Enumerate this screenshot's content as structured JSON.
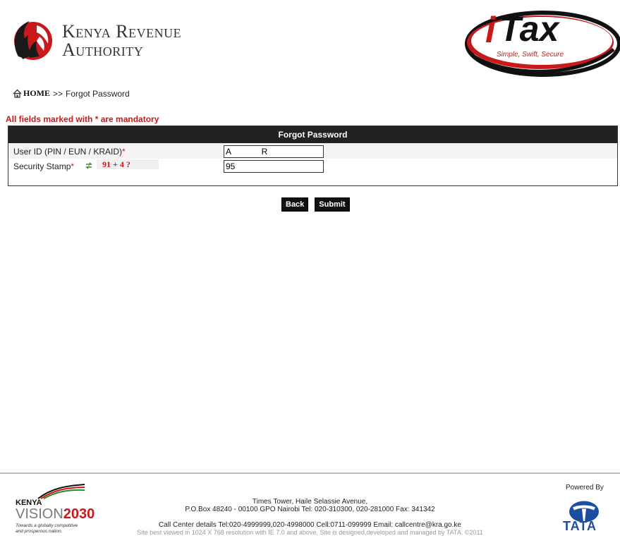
{
  "header": {
    "org_line1": "Kenya Revenue",
    "org_line2": "Authority",
    "itax_brand": "iTax",
    "itax_tagline": "Simple, Swift, Secure"
  },
  "breadcrumb": {
    "home": "HOME",
    "separator": ">>",
    "current": "Forgot Password"
  },
  "mandatory_note": "All fields marked with * are mandatory",
  "form": {
    "title": "Forgot Password",
    "user_id_label": "User ID (PIN / EUN / KRAID)",
    "user_id_value": "A             R",
    "security_label": "Security Stamp",
    "required_mark": "*",
    "captcha_text": "91 + 4 ?",
    "security_value": "95"
  },
  "buttons": {
    "back": "Back",
    "submit": "Submit"
  },
  "footer": {
    "vision_kenya": "KENYA",
    "vision_word": "VISION",
    "vision_year": "2030",
    "vision_tag1": "Towards a globally competitive",
    "vision_tag2": "and prosperous nation.",
    "address1": "Times Tower, Haile Selassie Avenue,",
    "address2": "P.O.Box 48240 - 00100 GPO Nairobi Tel: 020-310300, 020-281000 Fax: 341342",
    "callcenter": "Call Center details Tel:020-4999999,020-4998000 Cell:0711-099999 Email: callcentre@kra.go.ke",
    "best_viewed": "Site best viewed in 1024 X 768 resolution with IE 7.0 and above. Site is designed,developed and managed by TATA. ©2011",
    "powered_by": "Powered By",
    "tata": "TATA"
  },
  "colors": {
    "brand_red": "#c8191b",
    "header_bar": "#222222",
    "tata_blue": "#1c4e9e"
  }
}
